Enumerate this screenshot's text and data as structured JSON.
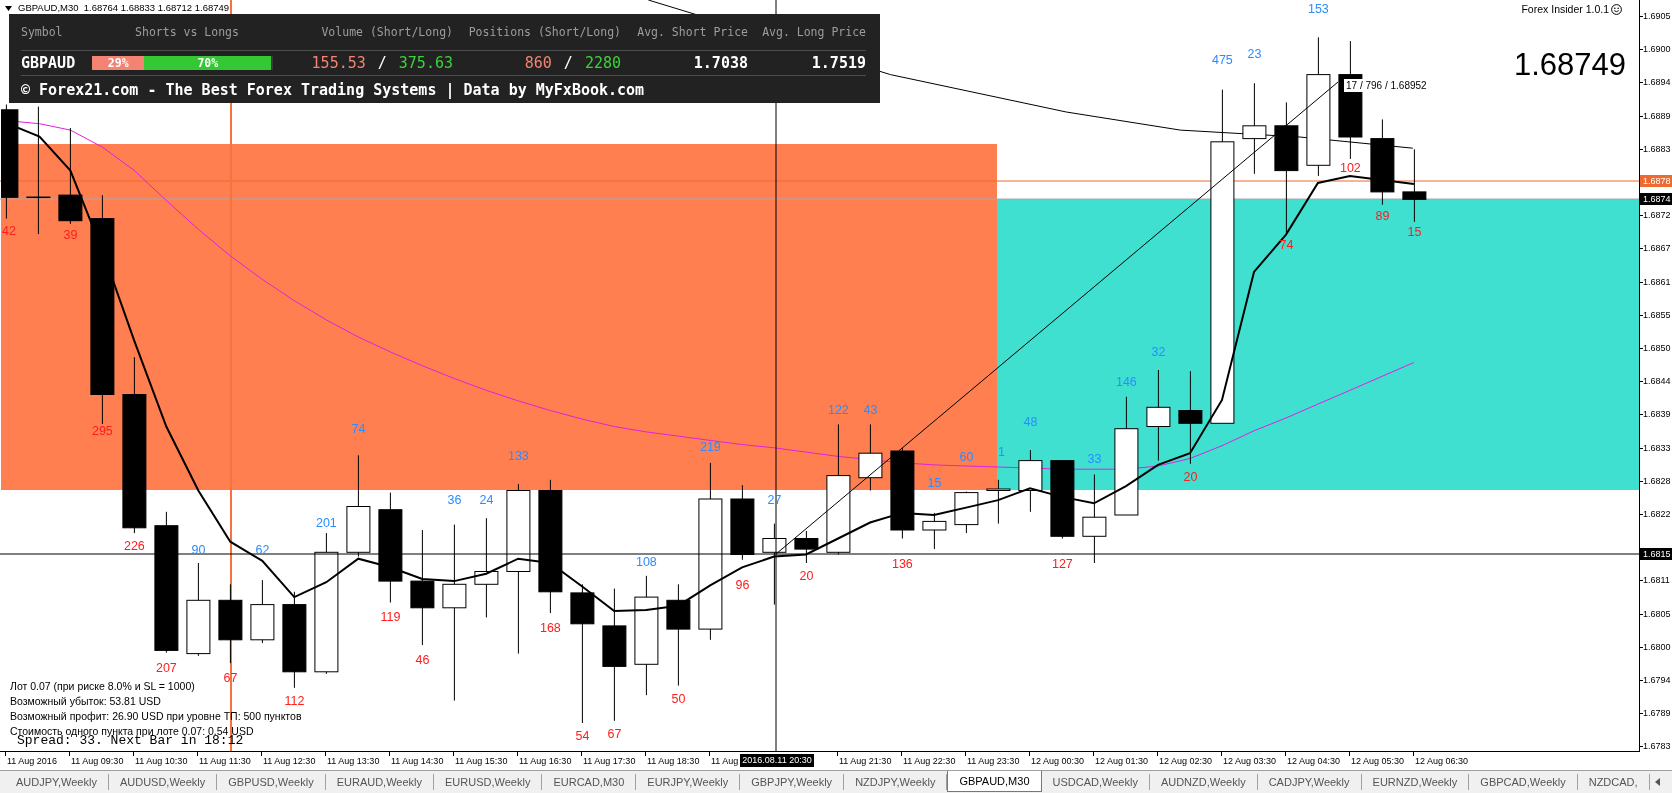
{
  "chart_title": "GBPAUD,M30  1.68764 1.68833 1.68712 1.68749",
  "insider_panel": {
    "columns": [
      "Symbol",
      "Shorts vs Longs",
      "Volume (Short/Long)",
      "Positions (Short/Long)",
      "Avg. Short Price",
      "Avg. Long Price"
    ],
    "row": {
      "symbol": "GBPAUD",
      "shares": [
        {
          "kind": "short",
          "label": "29%",
          "level": 0.29
        },
        {
          "kind": "long",
          "label": "70%",
          "level": 0.7
        }
      ],
      "volume": {
        "short": "155.53",
        "separator": "/",
        "long": "375.63"
      },
      "positions": {
        "short": "860",
        "separator": "/",
        "long": "2280"
      },
      "avg_short_price": "1.7038",
      "avg_long_price": "1.7519"
    },
    "footer": "© Forex21.com - The Best Forex Trading Systems | Data by MyFxBook.com"
  },
  "indicator_title": "Forex Insider 1.0.1",
  "current_price": "1.68749",
  "crosshair_readout": "17 / 796 / 1.68952",
  "candles": [
    {
      "kind": "bear",
      "label": "42"
    },
    {
      "kind": "doji"
    },
    {
      "kind": "bear",
      "label": "39"
    },
    {
      "kind": "bear",
      "label": "295"
    },
    {
      "kind": "bear",
      "label": "226"
    },
    {
      "kind": "bear",
      "label": "207"
    },
    {
      "kind": "bull",
      "label": "90"
    },
    {
      "kind": "bear",
      "label": "67"
    },
    {
      "kind": "bull",
      "label": "62"
    },
    {
      "kind": "bear",
      "label": "112"
    },
    {
      "kind": "bull",
      "label": "201"
    },
    {
      "kind": "bull",
      "label": "74"
    },
    {
      "kind": "bear",
      "label": "119"
    },
    {
      "kind": "bear",
      "label": "46"
    },
    {
      "kind": "bull",
      "label": "36"
    },
    {
      "kind": "bull",
      "label": "24"
    },
    {
      "kind": "bull",
      "label": "133"
    },
    {
      "kind": "bear",
      "label": "168"
    },
    {
      "kind": "bear",
      "label": "54"
    },
    {
      "kind": "bear",
      "label": "67"
    },
    {
      "kind": "bull",
      "label": "108"
    },
    {
      "kind": "bear",
      "label": "50"
    },
    {
      "kind": "bull",
      "label": "219"
    },
    {
      "kind": "bear",
      "label": "96"
    },
    {
      "kind": "bull",
      "label": "27"
    },
    {
      "kind": "bear",
      "label": "20"
    },
    {
      "kind": "bull",
      "label": "122"
    },
    {
      "kind": "bull",
      "label": "43"
    },
    {
      "kind": "bear",
      "label": "136"
    },
    {
      "kind": "bull",
      "label": "15"
    },
    {
      "kind": "bull",
      "label": "60"
    },
    {
      "kind": "bull",
      "label": "1"
    },
    {
      "kind": "bull",
      "label": "48"
    },
    {
      "kind": "bear",
      "label": "127"
    },
    {
      "kind": "bull",
      "label": "33"
    },
    {
      "kind": "bull",
      "label": "146"
    },
    {
      "kind": "bull",
      "label": "32"
    },
    {
      "kind": "bear",
      "label": "20"
    },
    {
      "kind": "bull",
      "label": "475"
    },
    {
      "kind": "bull",
      "label": "23"
    },
    {
      "kind": "bear",
      "label": "74"
    },
    {
      "kind": "bull",
      "label": "153"
    },
    {
      "kind": "bear",
      "label": "102"
    },
    {
      "kind": "bear",
      "label": "89"
    },
    {
      "kind": "bear",
      "label": "15"
    }
  ],
  "info_lines": [
    "Лот 0.07 (при риске 8.0% и SL = 1000)",
    "Возможный убыток: 53.81 USD",
    "Возможный профит: 26.90 USD при уровне ТП: 500 пунктов",
    "Стоимость одного пункта при лоте 0.07: 0.54 USD"
  ],
  "spread_line": "Spread: 33. Next Bar in 18:12",
  "price_axis": {
    "labels": [
      "1.6905",
      "1.6900",
      "1.6894",
      "1.6889",
      "1.6883",
      "1.6872",
      "1.6867",
      "1.6861",
      "1.6855",
      "1.6850",
      "1.6844",
      "1.6839",
      "1.6833",
      "1.6828",
      "1.6822",
      "1.6811",
      "1.6805",
      "1.6800",
      "1.6794",
      "1.6789",
      "1.6783"
    ],
    "markers": [
      {
        "kind": "level",
        "label": "1.6878"
      },
      {
        "kind": "bid",
        "label": "1.6874"
      },
      {
        "kind": "crosshair",
        "label": "1.6815"
      }
    ]
  },
  "time_axis": {
    "labels": [
      "11 Aug 2016",
      "11 Aug 09:30",
      "11 Aug 10:30",
      "11 Aug 11:30",
      "11 Aug 12:30",
      "11 Aug 13:30",
      "11 Aug 14:30",
      "11 Aug 15:30",
      "11 Aug 16:30",
      "11 Aug 17:30",
      "11 Aug 18:30",
      "11 Aug",
      "11 Aug 21:30",
      "11 Aug 22:30",
      "11 Aug 23:30",
      "12 Aug 00:30",
      "12 Aug 01:30",
      "12 Aug 02:30",
      "12 Aug 03:30",
      "12 Aug 04:30",
      "12 Aug 05:30",
      "12 Aug 06:30"
    ],
    "cursor_label": "2016.08.11 20:30"
  },
  "tabs": [
    {
      "label": "AUDJPY,Weekly",
      "selected": false
    },
    {
      "label": "AUDUSD,Weekly",
      "selected": false
    },
    {
      "label": "GBPUSD,Weekly",
      "selected": false
    },
    {
      "label": "EURAUD,Weekly",
      "selected": false
    },
    {
      "label": "EURUSD,Weekly",
      "selected": false
    },
    {
      "label": "EURCAD,M30",
      "selected": false
    },
    {
      "label": "EURJPY,Weekly",
      "selected": false
    },
    {
      "label": "GBPJPY,Weekly",
      "selected": false
    },
    {
      "label": "NZDJPY,Weekly",
      "selected": false
    },
    {
      "label": "GBPAUD,M30",
      "selected": true
    },
    {
      "label": "USDCAD,Weekly",
      "selected": false
    },
    {
      "label": "AUDNZD,Weekly",
      "selected": false
    },
    {
      "label": "CADJPY,Weekly",
      "selected": false
    },
    {
      "label": "EURNZD,Weekly",
      "selected": false
    },
    {
      "label": "GBPCAD,Weekly",
      "selected": false
    },
    {
      "label": "NZDCAD,",
      "selected": false
    }
  ]
}
